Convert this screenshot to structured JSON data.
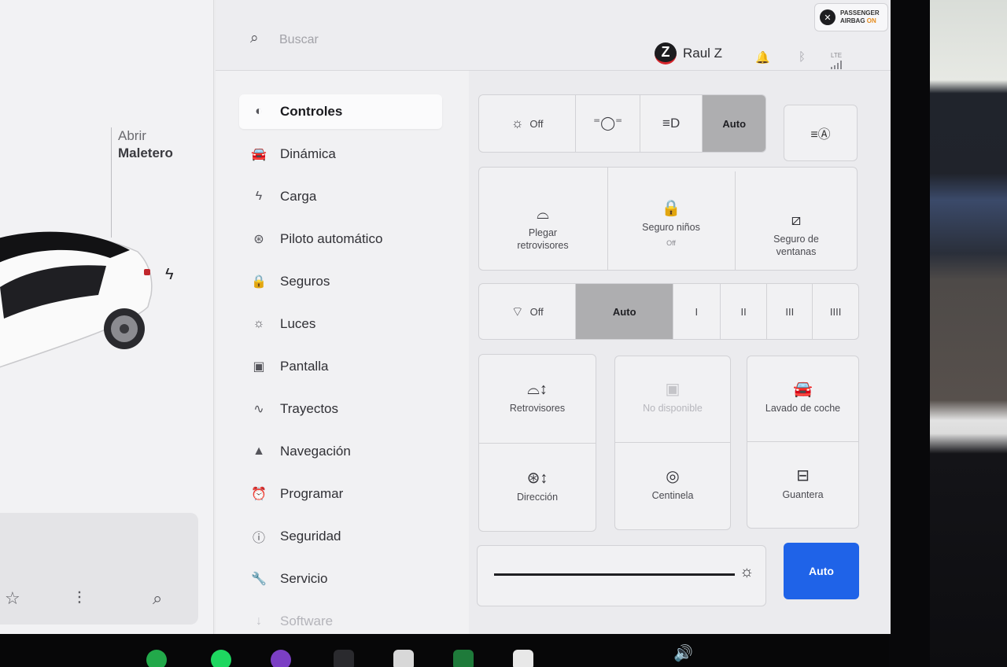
{
  "car_panel": {
    "trunk_line1": "Abrir",
    "trunk_line2": "Maletero",
    "charge_icon": "lightning-icon",
    "tray_icons": [
      "star-icon",
      "sliders-icon",
      "search-icon"
    ]
  },
  "topbar": {
    "search_placeholder": "Buscar",
    "profile_name": "Raul Z",
    "profile_logo": "Z",
    "icons": [
      "bell-icon",
      "bluetooth-icon",
      "lte-signal-icon"
    ],
    "lte_label": "LTE",
    "airbag_line1": "PASSENGER",
    "airbag_line2": "AIRBAG",
    "airbag_state": "ON"
  },
  "menu": {
    "items": [
      {
        "label": "Controles",
        "icon": "toggle-icon",
        "glyph": "◐"
      },
      {
        "label": "Dinámica",
        "icon": "car-icon",
        "glyph": "🚘"
      },
      {
        "label": "Carga",
        "icon": "lightning-icon",
        "glyph": "ϟ"
      },
      {
        "label": "Piloto automático",
        "icon": "steering-wheel-icon",
        "glyph": "⊛"
      },
      {
        "label": "Seguros",
        "icon": "lock-icon",
        "glyph": "🔒"
      },
      {
        "label": "Luces",
        "icon": "sun-icon",
        "glyph": "☼"
      },
      {
        "label": "Pantalla",
        "icon": "display-icon",
        "glyph": "▣"
      },
      {
        "label": "Trayectos",
        "icon": "trips-icon",
        "glyph": "∿"
      },
      {
        "label": "Navegación",
        "icon": "navigation-icon",
        "glyph": "▲"
      },
      {
        "label": "Programar",
        "icon": "alarm-clock-icon",
        "glyph": "⏰"
      },
      {
        "label": "Seguridad",
        "icon": "alert-circle-icon",
        "glyph": "ⓘ"
      },
      {
        "label": "Servicio",
        "icon": "wrench-icon",
        "glyph": "🔧"
      },
      {
        "label": "Software",
        "icon": "download-icon",
        "glyph": "↓"
      }
    ]
  },
  "lights": {
    "off_label": "Off",
    "auto_label": "Auto",
    "selected": "Auto"
  },
  "mirrors_row": {
    "fold_line1": "Plegar",
    "fold_line2": "retrovisores",
    "child_lock_label": "Seguro niños",
    "child_lock_state": "Off",
    "window_lock_line1": "Seguro de",
    "window_lock_line2": "ventanas"
  },
  "wipers": {
    "off_label": "Off",
    "auto_label": "Auto",
    "speeds": [
      "I",
      "II",
      "III",
      "IIII"
    ],
    "selected": "Auto"
  },
  "tiles": {
    "mirrors": "Retrovisores",
    "unavailable": "No disponible",
    "car_wash": "Lavado de coche",
    "steering": "Dirección",
    "sentry": "Centinela",
    "glovebox": "Guantera"
  },
  "display": {
    "brightness_auto": "Auto",
    "brightness_level": 0.95
  }
}
